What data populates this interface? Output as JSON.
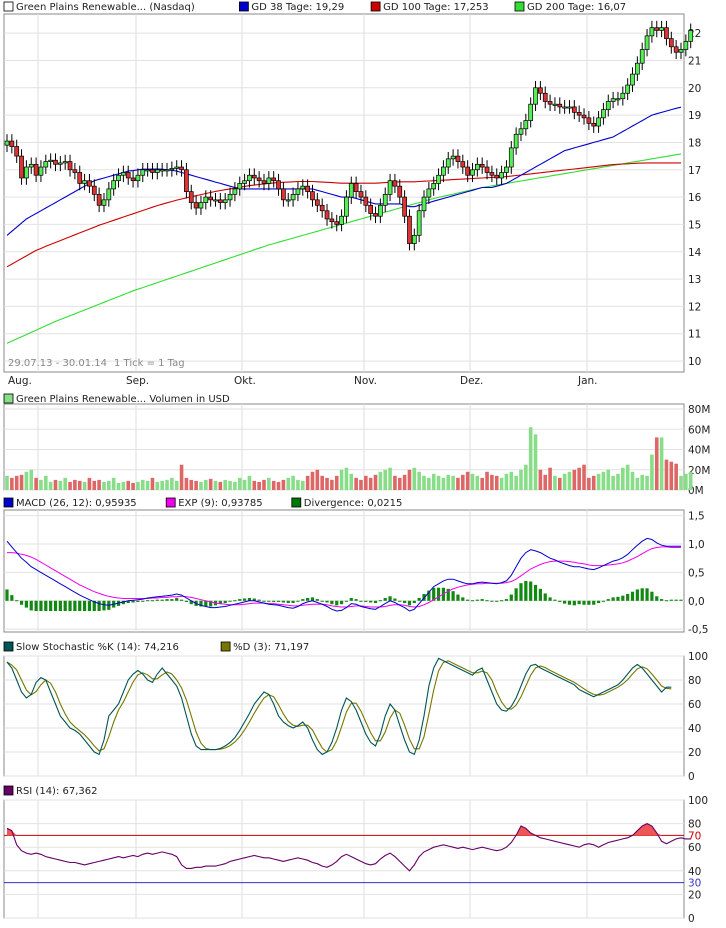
{
  "chart_data": [
    {
      "type": "candlestick",
      "legend": [
        {
          "name": "Green Plains Renewable... (Nasdaq)",
          "color": "#ffffff"
        },
        {
          "name": "GD 38 Tage: 19,29",
          "color": "#0000cc"
        },
        {
          "name": "GD 100 Tage: 17,253",
          "color": "#cc0000"
        },
        {
          "name": "GD 200 Tage: 16,07",
          "color": "#33dd33"
        }
      ],
      "range_label": "29.07.13 - 30.01.14",
      "tick_label": "1 Tick = 1 Tag",
      "x_labels": [
        "Aug.",
        "Sep.",
        "Okt.",
        "Nov.",
        "Dez.",
        "Jan."
      ],
      "y_ticks": [
        10,
        11,
        12,
        13,
        14,
        15,
        16,
        17,
        18,
        19,
        20,
        21,
        22
      ],
      "ylim": [
        9.6,
        22.7
      ],
      "close": [
        18.05,
        17.85,
        17.5,
        16.7,
        17.1,
        17.2,
        16.8,
        17.1,
        17.3,
        17.35,
        17.2,
        17.25,
        17.3,
        17.0,
        16.9,
        16.5,
        16.6,
        16.4,
        16.1,
        15.7,
        15.9,
        16.3,
        16.6,
        16.8,
        16.9,
        16.7,
        16.6,
        16.8,
        17.0,
        17.0,
        16.9,
        17.0,
        17.0,
        17.0,
        17.05,
        17.1,
        17.0,
        16.2,
        15.8,
        15.6,
        15.8,
        16.0,
        15.9,
        15.9,
        15.8,
        15.9,
        16.1,
        16.3,
        16.5,
        16.6,
        16.8,
        16.7,
        16.6,
        16.5,
        16.7,
        16.6,
        16.3,
        15.9,
        15.9,
        16.1,
        16.3,
        16.4,
        16.2,
        15.9,
        15.7,
        15.5,
        15.2,
        15.1,
        15.0,
        15.3,
        16.0,
        16.5,
        16.2,
        16.0,
        15.7,
        15.4,
        15.3,
        15.7,
        16.1,
        16.6,
        16.4,
        16.0,
        15.3,
        14.3,
        14.6,
        15.5,
        16.0,
        16.3,
        16.5,
        16.8,
        17.1,
        17.4,
        17.5,
        17.3,
        17.1,
        16.8,
        17.0,
        17.2,
        17.1,
        16.9,
        16.8,
        16.7,
        16.9,
        17.1,
        17.8,
        18.3,
        18.5,
        18.8,
        19.4,
        20.0,
        19.8,
        19.5,
        19.4,
        19.4,
        19.3,
        19.3,
        19.3,
        19.1,
        19.0,
        18.9,
        18.7,
        18.6,
        18.9,
        19.2,
        19.5,
        19.6,
        19.6,
        19.8,
        20.1,
        20.5,
        20.9,
        21.4,
        21.9,
        22.2,
        22.1,
        22.2,
        21.8,
        21.5,
        21.3,
        21.4,
        21.7,
        22.1
      ],
      "sma38": [
        14.6,
        14.75,
        14.9,
        15.05,
        15.2,
        15.3,
        15.4,
        15.5,
        15.6,
        15.7,
        15.8,
        15.9,
        16.0,
        16.1,
        16.2,
        16.3,
        16.4,
        16.5,
        16.6,
        16.65,
        16.7,
        16.75,
        16.8,
        16.85,
        16.9,
        16.95,
        16.97,
        17.0,
        17.02,
        17.02,
        17.03,
        17.03,
        17.02,
        17.0,
        16.98,
        16.95,
        16.9,
        16.85,
        16.8,
        16.75,
        16.7,
        16.65,
        16.6,
        16.55,
        16.5,
        16.45,
        16.4,
        16.35,
        16.3,
        16.3,
        16.3,
        16.3,
        16.3,
        16.3,
        16.3,
        16.3,
        16.3,
        16.3,
        16.3,
        16.3,
        16.3,
        16.3,
        16.3,
        16.3,
        16.25,
        16.2,
        16.15,
        16.1,
        16.05,
        16.0,
        16.0,
        16.0,
        15.95,
        15.9,
        15.85,
        15.8,
        15.75,
        15.75,
        15.75,
        15.75,
        15.75,
        15.75,
        15.7,
        15.65,
        15.65,
        15.7,
        15.75,
        15.8,
        15.85,
        15.9,
        15.95,
        16.0,
        16.05,
        16.1,
        16.15,
        16.2,
        16.25,
        16.3,
        16.35,
        16.35,
        16.35,
        16.4,
        16.45,
        16.5,
        16.6,
        16.7,
        16.8,
        16.9,
        17.0,
        17.1,
        17.2,
        17.3,
        17.4,
        17.5,
        17.6,
        17.7,
        17.75,
        17.8,
        17.85,
        17.9,
        17.95,
        18.0,
        18.05,
        18.1,
        18.15,
        18.2,
        18.3,
        18.4,
        18.5,
        18.6,
        18.7,
        18.8,
        18.9,
        19.0,
        19.05,
        19.1,
        19.15,
        19.2,
        19.25,
        19.29
      ],
      "sma100": [
        13.45,
        13.55,
        13.65,
        13.75,
        13.85,
        13.95,
        14.05,
        14.12,
        14.2,
        14.27,
        14.34,
        14.41,
        14.48,
        14.55,
        14.62,
        14.69,
        14.76,
        14.83,
        14.9,
        14.97,
        15.03,
        15.09,
        15.15,
        15.21,
        15.27,
        15.33,
        15.39,
        15.45,
        15.51,
        15.57,
        15.63,
        15.69,
        15.74,
        15.79,
        15.84,
        15.89,
        15.93,
        15.97,
        16.01,
        16.05,
        16.09,
        16.13,
        16.17,
        16.21,
        16.24,
        16.27,
        16.3,
        16.33,
        16.36,
        16.39,
        16.42,
        16.44,
        16.46,
        16.48,
        16.5,
        16.52,
        16.53,
        16.54,
        16.55,
        16.56,
        16.57,
        16.57,
        16.57,
        16.57,
        16.56,
        16.55,
        16.54,
        16.53,
        16.52,
        16.51,
        16.51,
        16.51,
        16.51,
        16.51,
        16.51,
        16.51,
        16.51,
        16.52,
        16.53,
        16.54,
        16.55,
        16.56,
        16.56,
        16.56,
        16.56,
        16.57,
        16.58,
        16.59,
        16.6,
        16.61,
        16.62,
        16.63,
        16.64,
        16.65,
        16.66,
        16.67,
        16.68,
        16.69,
        16.7,
        16.71,
        16.72,
        16.73,
        16.74,
        16.75,
        16.77,
        16.79,
        16.81,
        16.83,
        16.85,
        16.87,
        16.89,
        16.91,
        16.93,
        16.95,
        16.97,
        16.99,
        17.01,
        17.03,
        17.05,
        17.07,
        17.09,
        17.11,
        17.13,
        17.15,
        17.17,
        17.19,
        17.2,
        17.21,
        17.22,
        17.23,
        17.24,
        17.245,
        17.25,
        17.252,
        17.253,
        17.253,
        17.253,
        17.253,
        17.253,
        17.253
      ],
      "sma200": [
        10.65,
        10.73,
        10.81,
        10.89,
        10.97,
        11.05,
        11.13,
        11.21,
        11.29,
        11.37,
        11.45,
        11.52,
        11.59,
        11.66,
        11.73,
        11.8,
        11.87,
        11.94,
        12.01,
        12.08,
        12.15,
        12.22,
        12.29,
        12.36,
        12.43,
        12.5,
        12.57,
        12.63,
        12.69,
        12.75,
        12.81,
        12.87,
        12.93,
        12.99,
        13.05,
        13.11,
        13.17,
        13.23,
        13.29,
        13.35,
        13.41,
        13.47,
        13.53,
        13.59,
        13.65,
        13.71,
        13.77,
        13.83,
        13.89,
        13.95,
        14.01,
        14.07,
        14.13,
        14.19,
        14.25,
        14.3,
        14.35,
        14.4,
        14.45,
        14.5,
        14.55,
        14.6,
        14.65,
        14.7,
        14.75,
        14.8,
        14.85,
        14.9,
        14.95,
        15.0,
        15.05,
        15.1,
        15.15,
        15.2,
        15.25,
        15.3,
        15.35,
        15.4,
        15.45,
        15.5,
        15.55,
        15.6,
        15.65,
        15.7,
        15.75,
        15.8,
        15.85,
        15.9,
        15.95,
        15.99,
        16.03,
        16.07,
        16.11,
        16.15,
        16.19,
        16.23,
        16.27,
        16.31,
        16.35,
        16.38,
        16.41,
        16.44,
        16.47,
        16.5,
        16.53,
        16.56,
        16.59,
        16.62,
        16.65,
        16.68,
        16.71,
        16.74,
        16.77,
        16.8,
        16.83,
        16.86,
        16.89,
        16.92,
        16.95,
        16.98,
        17.01,
        17.04,
        17.07,
        17.1,
        17.13,
        17.16,
        17.19,
        17.22,
        17.25,
        17.28,
        17.31,
        17.34,
        17.37,
        17.4,
        17.43,
        17.46,
        17.49,
        17.52,
        17.55,
        17.58
      ]
    },
    {
      "type": "bar",
      "legend": [
        {
          "name": "Green Plains Renewable... Volumen in USD",
          "color": "#88dd88"
        }
      ],
      "y_ticks": [
        "0M",
        "20M",
        "40M",
        "60M",
        "80M"
      ],
      "ylim": [
        0,
        85
      ],
      "values": [
        14,
        12,
        14,
        15,
        18,
        20,
        12,
        10,
        14,
        8,
        10,
        9,
        12,
        8,
        10,
        9,
        8,
        12,
        9,
        10,
        8,
        9,
        12,
        7,
        8,
        9,
        7,
        8,
        10,
        9,
        12,
        8,
        9,
        10,
        12,
        9,
        25,
        12,
        10,
        9,
        8,
        10,
        11,
        9,
        8,
        10,
        9,
        8,
        12,
        10,
        14,
        9,
        8,
        10,
        12,
        9,
        8,
        10,
        12,
        14,
        10,
        9,
        14,
        18,
        20,
        14,
        12,
        10,
        14,
        20,
        22,
        16,
        12,
        10,
        14,
        12,
        15,
        18,
        20,
        22,
        14,
        12,
        15,
        20,
        22,
        18,
        14,
        12,
        16,
        14,
        12,
        15,
        14,
        12,
        15,
        18,
        16,
        14,
        12,
        18,
        15,
        14,
        12,
        16,
        18,
        14,
        20,
        25,
        62,
        55,
        20,
        15,
        22,
        14,
        12,
        16,
        18,
        20,
        22,
        25,
        12,
        14,
        16,
        18,
        20,
        14,
        16,
        22,
        25,
        18,
        12,
        15,
        14,
        35,
        52,
        52,
        30,
        28,
        26,
        14,
        16,
        18
      ]
    },
    {
      "type": "line",
      "legend": [
        {
          "name": "MACD (26, 12): 0,95935",
          "color": "#0000cc"
        },
        {
          "name": "EXP (9): 0,93785",
          "color": "#ee00ee"
        },
        {
          "name": "Divergence: 0,0215",
          "color": "#007700"
        }
      ],
      "y_ticks": [
        "-0,5",
        "0,0",
        "0,5",
        "1,0",
        "1,5"
      ],
      "ylim": [
        -0.55,
        1.6
      ],
      "macd": [
        1.05,
        0.95,
        0.85,
        0.75,
        0.68,
        0.6,
        0.55,
        0.5,
        0.45,
        0.4,
        0.35,
        0.3,
        0.25,
        0.2,
        0.15,
        0.1,
        0.06,
        0.02,
        -0.02,
        -0.05,
        -0.07,
        -0.08,
        -0.06,
        -0.04,
        -0.02,
        0.0,
        0.01,
        0.02,
        0.03,
        0.05,
        0.06,
        0.07,
        0.08,
        0.09,
        0.1,
        0.12,
        0.1,
        0.05,
        0.0,
        -0.05,
        -0.08,
        -0.1,
        -0.12,
        -0.12,
        -0.11,
        -0.1,
        -0.08,
        -0.06,
        -0.04,
        -0.02,
        0.0,
        0.0,
        -0.02,
        -0.04,
        -0.06,
        -0.07,
        -0.08,
        -0.1,
        -0.12,
        -0.13,
        -0.1,
        -0.05,
        -0.02,
        0.0,
        -0.03,
        -0.06,
        -0.1,
        -0.15,
        -0.18,
        -0.17,
        -0.12,
        -0.05,
        -0.06,
        -0.1,
        -0.12,
        -0.14,
        -0.15,
        -0.1,
        -0.05,
        0.0,
        -0.03,
        -0.08,
        -0.12,
        -0.18,
        -0.15,
        -0.05,
        0.05,
        0.15,
        0.25,
        0.3,
        0.35,
        0.38,
        0.38,
        0.35,
        0.32,
        0.3,
        0.3,
        0.32,
        0.33,
        0.32,
        0.31,
        0.3,
        0.32,
        0.35,
        0.45,
        0.6,
        0.75,
        0.85,
        0.9,
        0.88,
        0.85,
        0.8,
        0.75,
        0.72,
        0.68,
        0.65,
        0.62,
        0.6,
        0.6,
        0.58,
        0.56,
        0.55,
        0.58,
        0.62,
        0.66,
        0.7,
        0.72,
        0.76,
        0.82,
        0.9,
        0.98,
        1.05,
        1.1,
        1.08,
        1.02,
        0.98,
        0.96,
        0.96,
        0.96,
        0.96
      ],
      "exp": [
        0.85,
        0.85,
        0.84,
        0.82,
        0.8,
        0.77,
        0.73,
        0.68,
        0.63,
        0.58,
        0.53,
        0.48,
        0.43,
        0.38,
        0.33,
        0.28,
        0.24,
        0.2,
        0.16,
        0.13,
        0.1,
        0.08,
        0.06,
        0.05,
        0.04,
        0.04,
        0.04,
        0.04,
        0.04,
        0.04,
        0.05,
        0.05,
        0.06,
        0.06,
        0.07,
        0.07,
        0.08,
        0.07,
        0.06,
        0.04,
        0.02,
        0.0,
        -0.02,
        -0.04,
        -0.05,
        -0.06,
        -0.07,
        -0.07,
        -0.07,
        -0.06,
        -0.05,
        -0.04,
        -0.04,
        -0.04,
        -0.05,
        -0.05,
        -0.06,
        -0.07,
        -0.08,
        -0.09,
        -0.09,
        -0.08,
        -0.07,
        -0.06,
        -0.06,
        -0.06,
        -0.07,
        -0.09,
        -0.1,
        -0.11,
        -0.11,
        -0.1,
        -0.09,
        -0.09,
        -0.1,
        -0.11,
        -0.11,
        -0.11,
        -0.1,
        -0.08,
        -0.07,
        -0.07,
        -0.08,
        -0.1,
        -0.11,
        -0.1,
        -0.07,
        -0.03,
        0.02,
        0.07,
        0.12,
        0.17,
        0.21,
        0.24,
        0.26,
        0.28,
        0.29,
        0.3,
        0.3,
        0.31,
        0.31,
        0.31,
        0.31,
        0.32,
        0.34,
        0.38,
        0.44,
        0.5,
        0.56,
        0.6,
        0.64,
        0.67,
        0.69,
        0.7,
        0.7,
        0.7,
        0.69,
        0.68,
        0.66,
        0.65,
        0.63,
        0.62,
        0.62,
        0.62,
        0.63,
        0.64,
        0.65,
        0.67,
        0.7,
        0.74,
        0.78,
        0.83,
        0.88,
        0.92,
        0.94,
        0.95,
        0.95,
        0.94,
        0.94,
        0.94
      ]
    },
    {
      "type": "line",
      "legend": [
        {
          "name": "Slow Stochastic %K (14): 74,216",
          "color": "#005555"
        },
        {
          "name": "%D (3): 71,197",
          "color": "#777700"
        }
      ],
      "y_ticks": [
        "0",
        "20",
        "40",
        "60",
        "80",
        "100"
      ],
      "ylim": [
        0,
        100
      ],
      "k": [
        95,
        90,
        80,
        70,
        65,
        68,
        78,
        82,
        80,
        70,
        60,
        50,
        45,
        40,
        38,
        35,
        30,
        25,
        20,
        18,
        30,
        50,
        55,
        60,
        70,
        80,
        85,
        88,
        85,
        80,
        78,
        85,
        90,
        85,
        80,
        75,
        65,
        50,
        35,
        25,
        22,
        22,
        22,
        22,
        23,
        25,
        28,
        32,
        38,
        45,
        52,
        60,
        65,
        70,
        68,
        60,
        50,
        45,
        42,
        40,
        42,
        45,
        40,
        30,
        22,
        18,
        20,
        28,
        40,
        55,
        65,
        62,
        55,
        45,
        35,
        28,
        25,
        35,
        50,
        60,
        55,
        42,
        30,
        20,
        18,
        30,
        50,
        75,
        90,
        98,
        96,
        94,
        92,
        90,
        88,
        86,
        84,
        88,
        90,
        80,
        70,
        60,
        55,
        54,
        58,
        65,
        75,
        85,
        92,
        93,
        90,
        88,
        86,
        84,
        82,
        80,
        78,
        76,
        72,
        70,
        68,
        66,
        68,
        70,
        72,
        74,
        76,
        80,
        85,
        90,
        93,
        90,
        85,
        80,
        75,
        70,
        74,
        74
      ]
    },
    {
      "type": "line",
      "legend": [
        {
          "name": "RSI (14): 67,362",
          "color": "#660066"
        }
      ],
      "y_ticks": [
        "0",
        "20",
        "30",
        "40",
        "60",
        "70",
        "80",
        "100"
      ],
      "reference_lines": [
        70,
        30
      ],
      "ylim": [
        0,
        100
      ],
      "values": [
        76,
        74,
        62,
        57,
        55,
        54,
        55,
        54,
        52,
        51,
        50,
        49,
        48,
        47,
        47,
        46,
        45,
        46,
        47,
        48,
        49,
        50,
        51,
        52,
        51,
        52,
        53,
        52,
        54,
        55,
        54,
        55,
        56,
        55,
        54,
        52,
        45,
        42,
        42,
        43,
        43,
        44,
        44,
        44,
        45,
        46,
        48,
        49,
        50,
        51,
        52,
        53,
        52,
        51,
        51,
        50,
        49,
        48,
        49,
        50,
        51,
        50,
        49,
        47,
        46,
        44,
        43,
        45,
        48,
        52,
        54,
        52,
        50,
        48,
        46,
        45,
        46,
        50,
        53,
        55,
        52,
        48,
        44,
        40,
        45,
        52,
        56,
        58,
        60,
        61,
        62,
        61,
        60,
        59,
        60,
        59,
        58,
        59,
        60,
        59,
        58,
        57,
        58,
        60,
        64,
        70,
        78,
        76,
        72,
        70,
        68,
        67,
        66,
        65,
        64,
        63,
        62,
        61,
        60,
        62,
        63,
        62,
        60,
        62,
        64,
        65,
        66,
        67,
        68,
        70,
        74,
        78,
        80,
        78,
        72,
        65,
        63,
        65,
        67,
        68,
        67,
        67
      ]
    }
  ]
}
